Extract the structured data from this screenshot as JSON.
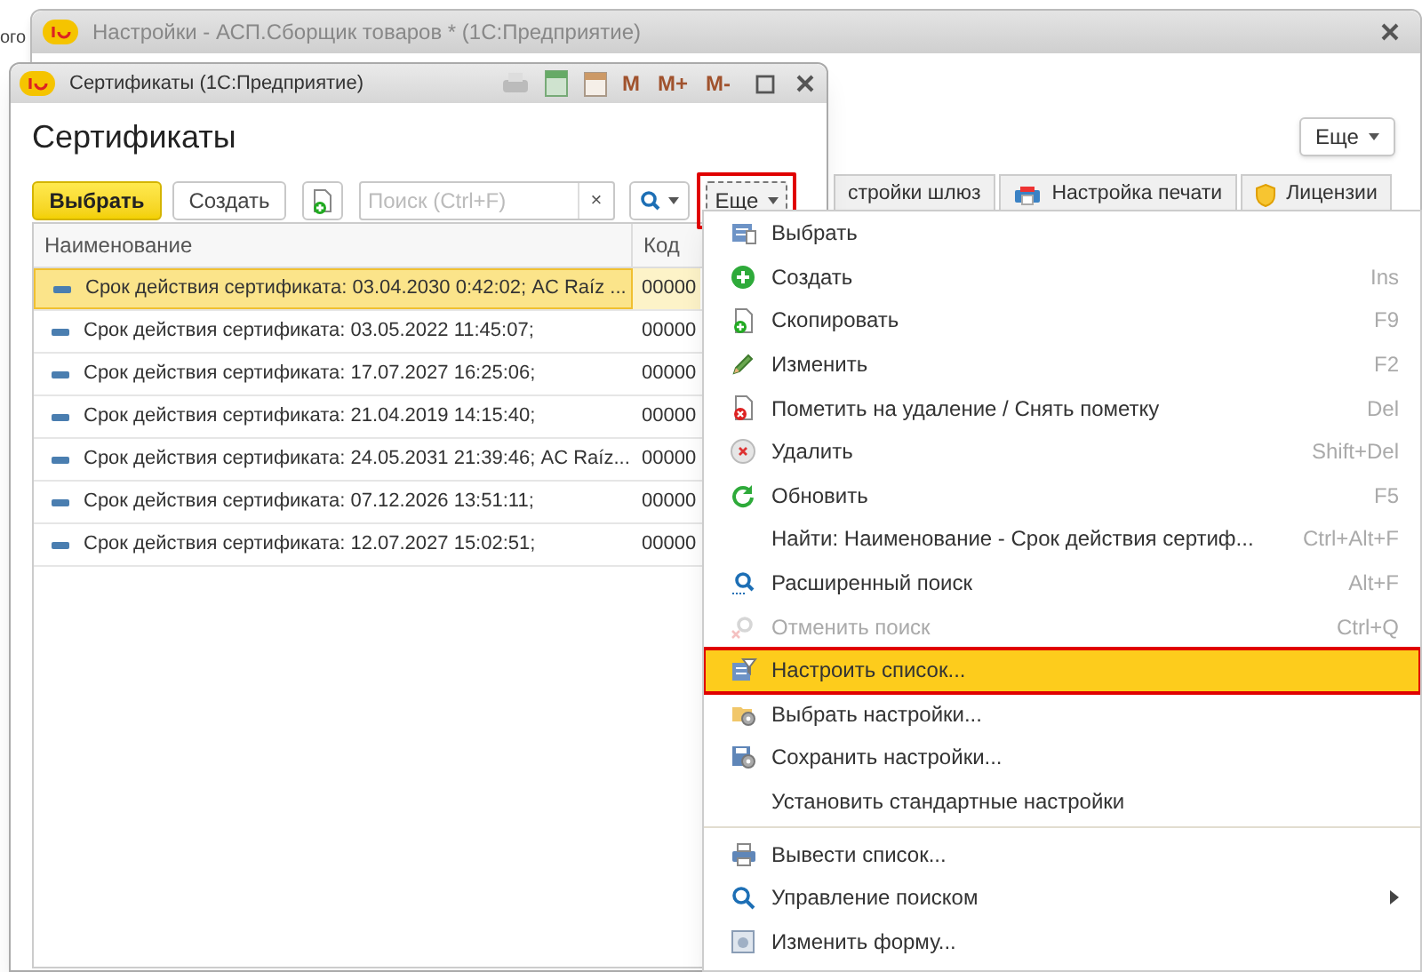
{
  "background_text": "ого",
  "back_window": {
    "title": "Настройки - АСП.Сборщик товаров *  (1С:Предприятие)",
    "more_button": "Еще",
    "tabs": [
      {
        "label": "стройки шлюз",
        "selected": false
      },
      {
        "label": "Настройка печати",
        "selected": false
      },
      {
        "label": "Лицензии",
        "selected": false
      }
    ]
  },
  "front_window": {
    "title": "Сертификаты  (1С:Предприятие)",
    "title_buttons": [
      "M",
      "M+",
      "M-"
    ],
    "heading": "Сертификаты",
    "toolbar": {
      "select_button": "Выбрать",
      "create_button": "Создать",
      "search": {
        "placeholder": "Поиск (Ctrl+F)"
      },
      "clear_button": "×",
      "more_button": {
        "label": "Еще",
        "highlighted": true
      }
    },
    "table": {
      "columns": [
        "Наименование",
        "Код"
      ],
      "rows": [
        {
          "name": "Срок действия сертификата: 03.04.2030 0:42:02; AC Raíz ...",
          "code": "00000",
          "selected": true
        },
        {
          "name": "Срок действия сертификата: 03.05.2022 11:45:07;",
          "code": "00000",
          "selected": false
        },
        {
          "name": "Срок действия сертификата: 17.07.2027 16:25:06;",
          "code": "00000",
          "selected": false
        },
        {
          "name": "Срок действия сертификата: 21.04.2019 14:15:40;",
          "code": "00000",
          "selected": false
        },
        {
          "name": "Срок действия сертификата: 24.05.2031 21:39:46; AC Raíz...",
          "code": "00000",
          "selected": false
        },
        {
          "name": "Срок действия сертификата: 07.12.2026 13:51:11;",
          "code": "00000",
          "selected": false
        },
        {
          "name": "Срок действия сертификата: 12.07.2027 15:02:51;",
          "code": "00000",
          "selected": false
        }
      ]
    }
  },
  "menu": {
    "groups": [
      [
        {
          "label": "Выбрать",
          "disabled": false,
          "selected": false,
          "highlighted": false
        },
        {
          "label": "Создать",
          "shortcut": "Ins",
          "disabled": false,
          "selected": false,
          "highlighted": false
        },
        {
          "label": "Скопировать",
          "shortcut": "F9",
          "disabled": false,
          "selected": false,
          "highlighted": false
        },
        {
          "label": "Изменить",
          "shortcut": "F2",
          "disabled": false,
          "selected": false,
          "highlighted": false
        },
        {
          "label": "Пометить на удаление / Снять пометку",
          "shortcut": "Del",
          "disabled": false,
          "selected": false,
          "highlighted": false
        },
        {
          "label": "Удалить",
          "shortcut": "Shift+Del",
          "disabled": false,
          "selected": false,
          "highlighted": false
        },
        {
          "label": "Обновить",
          "shortcut": "F5",
          "disabled": false,
          "selected": false,
          "highlighted": false
        },
        {
          "label": "Найти: Наименование - Срок действия сертиф...",
          "shortcut": "Ctrl+Alt+F",
          "disabled": false,
          "selected": false,
          "highlighted": false
        },
        {
          "label": "Расширенный поиск",
          "shortcut": "Alt+F",
          "disabled": false,
          "selected": false,
          "highlighted": false
        },
        {
          "label": "Отменить поиск",
          "shortcut": "Ctrl+Q",
          "disabled": true,
          "selected": false,
          "highlighted": false
        },
        {
          "label": "Настроить список...",
          "disabled": false,
          "selected": true,
          "highlighted": true
        },
        {
          "label": "Выбрать настройки...",
          "disabled": false,
          "selected": false,
          "highlighted": false
        },
        {
          "label": "Сохранить настройки...",
          "disabled": false,
          "selected": false,
          "highlighted": false
        },
        {
          "label": "Установить стандартные настройки",
          "disabled": false,
          "selected": false,
          "highlighted": false
        }
      ],
      [
        {
          "label": "Вывести список...",
          "disabled": false,
          "selected": false,
          "highlighted": false
        },
        {
          "label": "Управление поиском",
          "disabled": false,
          "selected": false,
          "highlighted": false,
          "submenu": true
        },
        {
          "label": "Изменить форму...",
          "disabled": false,
          "selected": false,
          "highlighted": false
        }
      ]
    ]
  }
}
